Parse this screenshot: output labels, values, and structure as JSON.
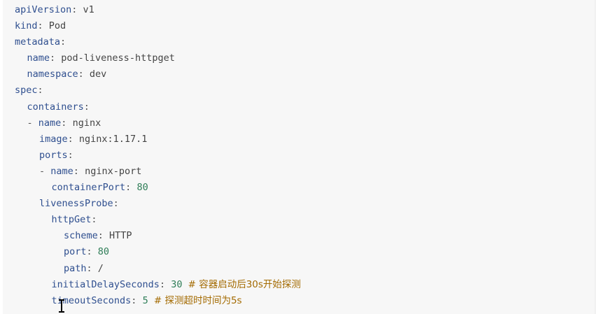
{
  "editor": {
    "lines": [
      {
        "key": "apiVersion",
        "value": "v1"
      },
      {
        "key": "kind",
        "value": "Pod"
      },
      {
        "key": "metadata"
      },
      {
        "key": "name",
        "value": "pod-liveness-httpget"
      },
      {
        "key": "namespace",
        "value": "dev"
      },
      {
        "key": "spec"
      },
      {
        "key": "containers"
      },
      {
        "dash": "-",
        "key": "name",
        "value": "nginx"
      },
      {
        "key": "image",
        "value": "nginx:1.17.1"
      },
      {
        "key": "ports"
      },
      {
        "dash": "-",
        "key": "name",
        "value": "nginx-port"
      },
      {
        "key": "containerPort",
        "value": "80"
      },
      {
        "key": "livenessProbe"
      },
      {
        "key": "httpGet"
      },
      {
        "key": "scheme",
        "value": "HTTP"
      },
      {
        "key": "port",
        "value": "80"
      },
      {
        "key": "path",
        "value": "/"
      },
      {
        "key": "initialDelaySeconds",
        "value": "30",
        "comment": "# 容器启动后30s开始探测"
      },
      {
        "key": "timeoutSeconds",
        "value": "5",
        "comment": "# 探测超时时间为5s"
      }
    ]
  },
  "colors": {
    "background": "#f7f7f7",
    "key": "#2f4f8f",
    "number": "#2e7d57",
    "comment": "#a36a00"
  },
  "icons": {
    "cursor": "text-cursor-icon"
  }
}
